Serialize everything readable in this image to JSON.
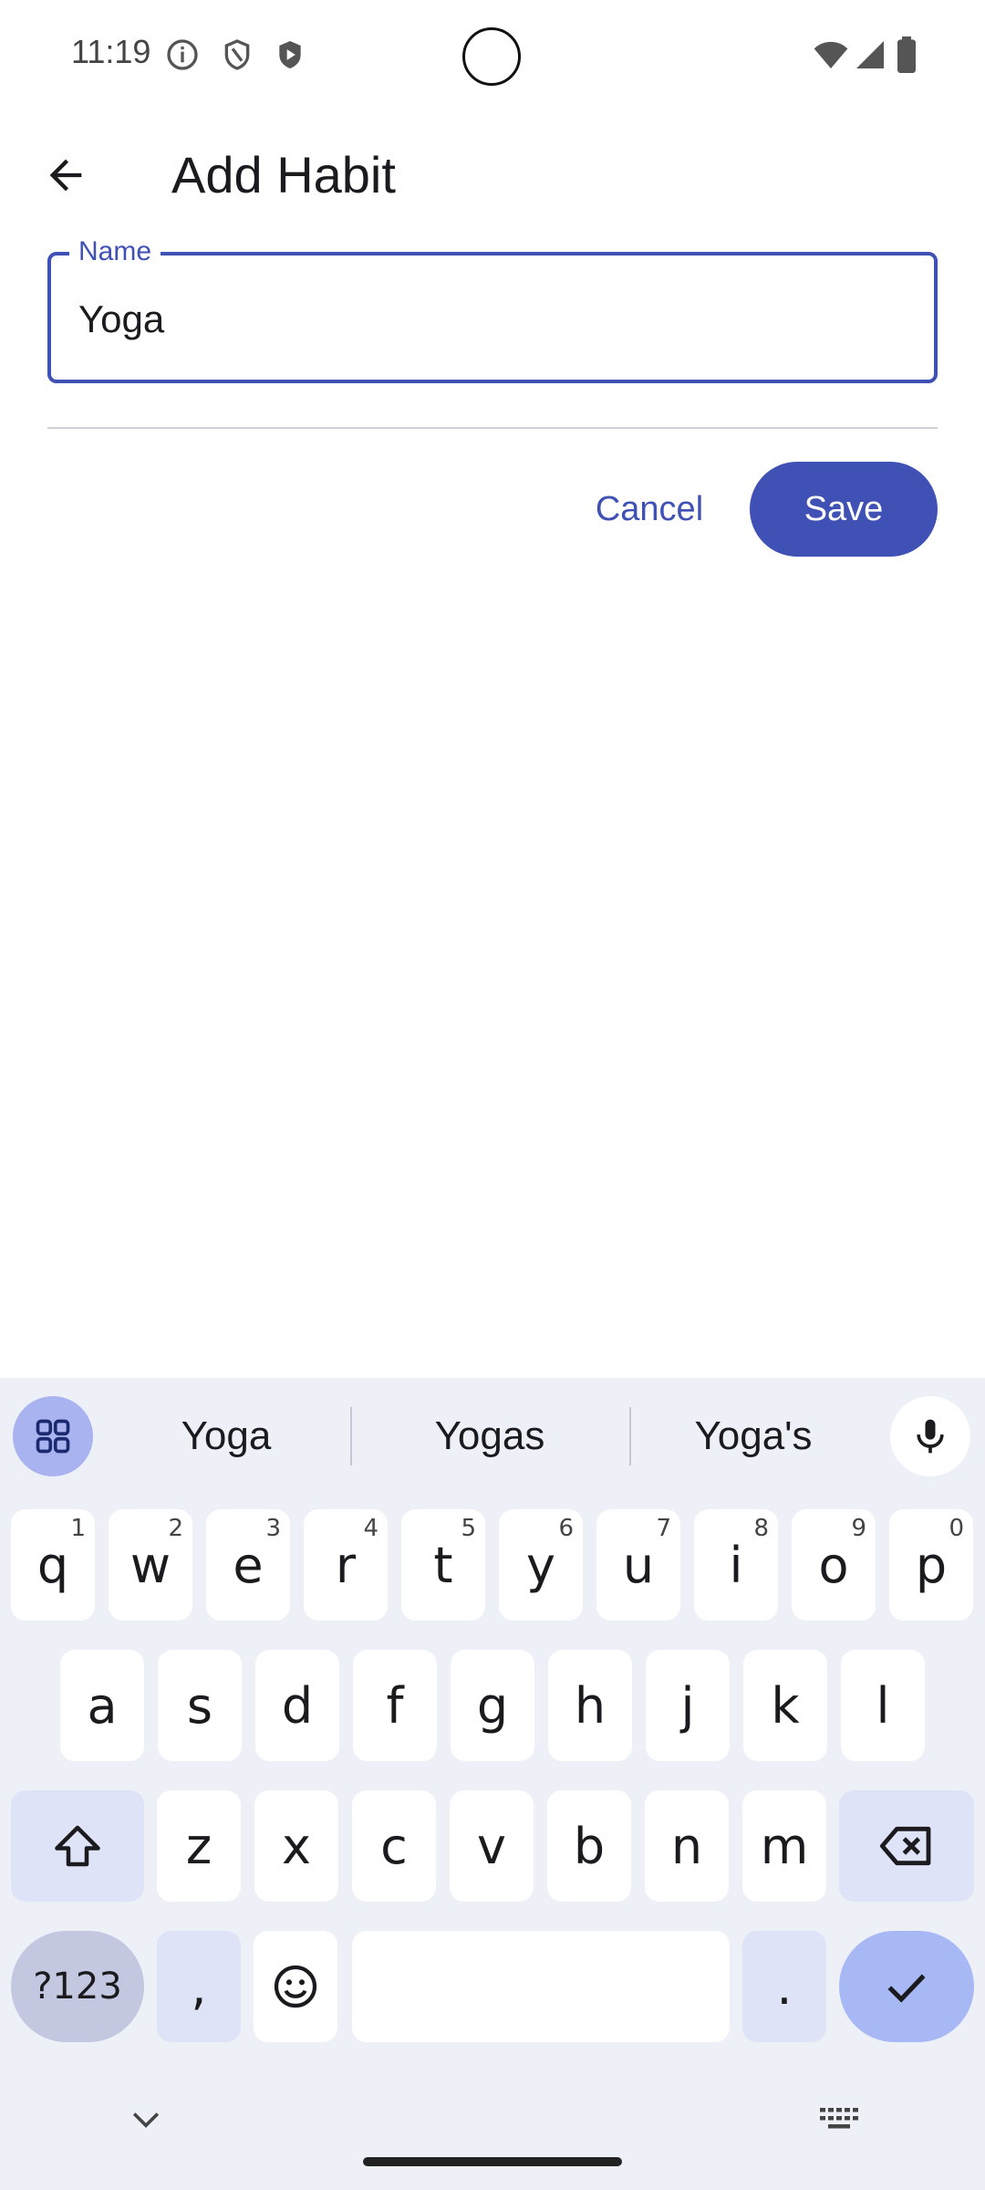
{
  "status_bar": {
    "time": "11:19"
  },
  "app_bar": {
    "title": "Add Habit"
  },
  "form": {
    "name_label": "Name",
    "name_value": "Yoga"
  },
  "actions": {
    "cancel_label": "Cancel",
    "save_label": "Save"
  },
  "keyboard": {
    "suggestions": [
      "Yoga",
      "Yogas",
      "Yoga's"
    ],
    "row1": [
      {
        "k": "q",
        "n": "1"
      },
      {
        "k": "w",
        "n": "2"
      },
      {
        "k": "e",
        "n": "3"
      },
      {
        "k": "r",
        "n": "4"
      },
      {
        "k": "t",
        "n": "5"
      },
      {
        "k": "y",
        "n": "6"
      },
      {
        "k": "u",
        "n": "7"
      },
      {
        "k": "i",
        "n": "8"
      },
      {
        "k": "o",
        "n": "9"
      },
      {
        "k": "p",
        "n": "0"
      }
    ],
    "row2": [
      "a",
      "s",
      "d",
      "f",
      "g",
      "h",
      "j",
      "k",
      "l"
    ],
    "row3": [
      "z",
      "x",
      "c",
      "v",
      "b",
      "n",
      "m"
    ],
    "symbols_label": "?123",
    "comma": ",",
    "period": "."
  },
  "colors": {
    "accent": "#3f51b5",
    "keyboard_bg": "#eef0f8"
  }
}
